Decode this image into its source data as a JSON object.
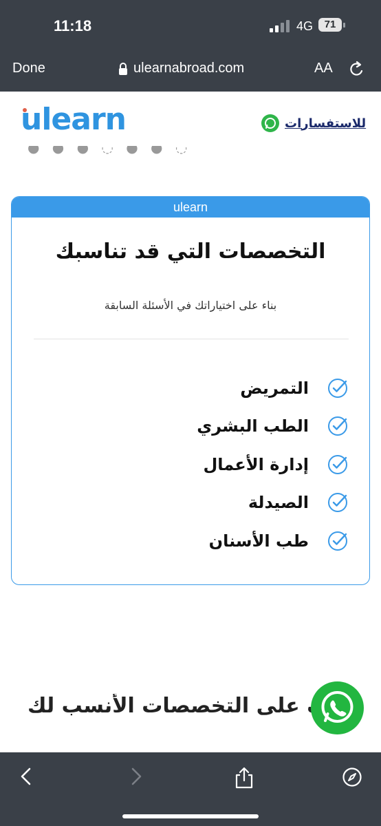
{
  "status_bar": {
    "time": "11:18",
    "network": "4G",
    "battery": "71"
  },
  "browser": {
    "done_label": "Done",
    "url": "ulearnabroad.com",
    "text_size_label": "AA"
  },
  "header": {
    "logo_text": "ulearn",
    "inquiry_link": "للاستفسارات"
  },
  "card": {
    "bar_label": "ulearn",
    "title": "التخصصات التي قد تناسبك",
    "subtitle": "بناء على اختياراتك في الأسئلة السابقة",
    "items": [
      "التمريض",
      "الطب البشري",
      "إدارة الأعمال",
      "الصيدلة",
      "طب الأسنان"
    ]
  },
  "bottom_heading": "ف على التخصصات الأنسب لك",
  "colors": {
    "accent": "#3a9ae8",
    "whatsapp": "#22b640",
    "chrome": "#3a4048",
    "logo": "#2f94e0"
  },
  "icons": [
    "lock-icon",
    "reload-icon",
    "whatsapp-icon",
    "check-circle-icon",
    "back-icon",
    "forward-icon",
    "share-icon",
    "compass-icon"
  ]
}
